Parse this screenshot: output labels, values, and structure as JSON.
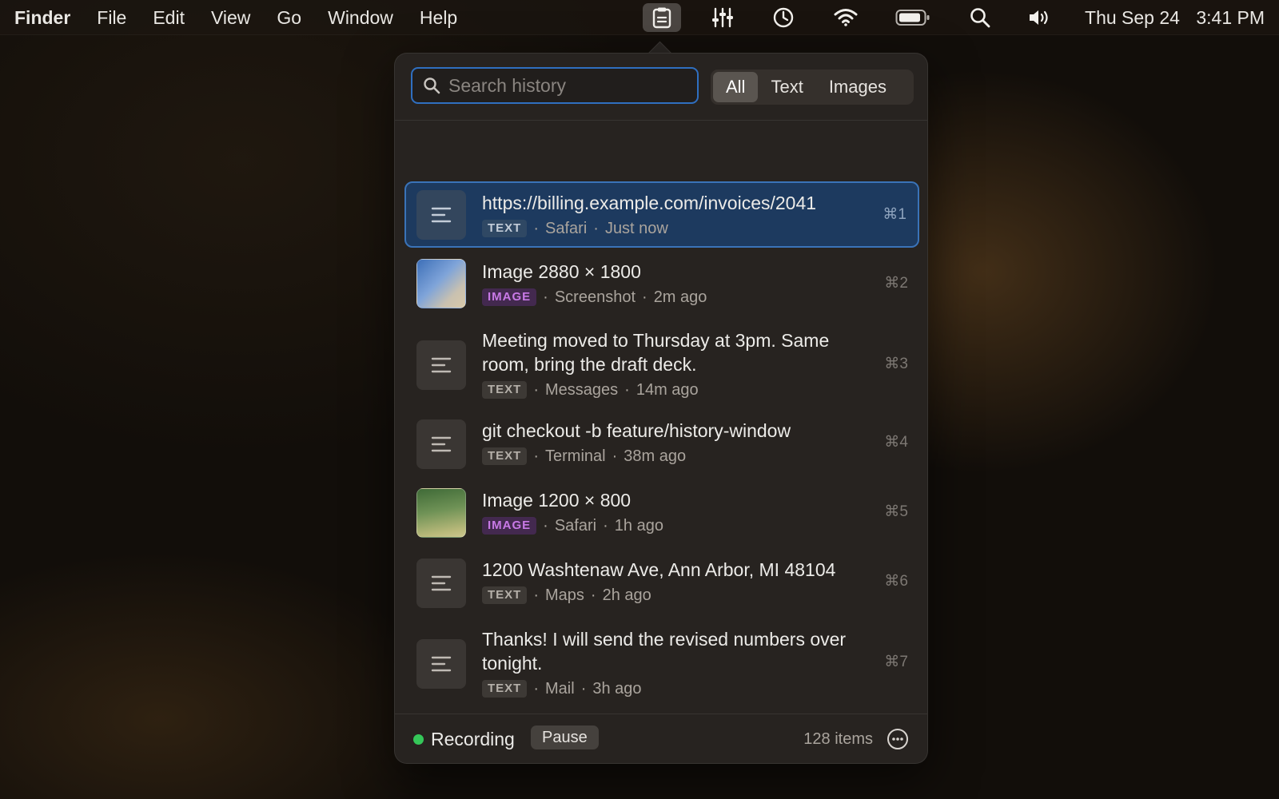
{
  "menubar": {
    "app_name": "Finder",
    "menus": [
      "File",
      "Edit",
      "View",
      "Go",
      "Window",
      "Help"
    ],
    "status_icons": [
      "clipboard-icon",
      "mixer-icon",
      "clock-icon",
      "wifi-icon",
      "battery-icon",
      "search-icon",
      "volume-icon"
    ],
    "date": "Thu Sep 24",
    "time": "3:41 PM"
  },
  "popover": {
    "search": {
      "placeholder": "Search history",
      "value": ""
    },
    "filters": [
      {
        "label": "All",
        "selected": true
      },
      {
        "label": "Text",
        "selected": false
      },
      {
        "label": "Images",
        "selected": false
      }
    ],
    "items": [
      {
        "title": "https://billing.example.com/invoices/2041",
        "type": "TEXT",
        "source": "Safari",
        "time": "Just now",
        "shortcut": "⌘1",
        "selected": true
      },
      {
        "title": "Image 2880 × 1800",
        "type": "IMAGE",
        "source": "Screenshot",
        "time": "2m ago",
        "shortcut": "⌘2"
      },
      {
        "title": "Meeting moved to Thursday at 3pm. Same room, bring the draft deck.",
        "type": "TEXT",
        "source": "Messages",
        "time": "14m ago",
        "shortcut": "⌘3"
      },
      {
        "title": "git checkout -b feature/history-window",
        "type": "TEXT",
        "source": "Terminal",
        "time": "38m ago",
        "shortcut": "⌘4"
      },
      {
        "title": "Image 1200 × 800",
        "type": "IMAGE",
        "source": "Safari",
        "time": "1h ago",
        "shortcut": "⌘5"
      },
      {
        "title": "1200 Washtenaw Ave, Ann Arbor, MI 48104",
        "type": "TEXT",
        "source": "Maps",
        "time": "2h ago",
        "shortcut": "⌘6"
      },
      {
        "title": "Thanks! I will send the revised numbers over tonight.",
        "type": "TEXT",
        "source": "Mail",
        "time": "3h ago",
        "shortcut": "⌘7"
      }
    ],
    "footer": {
      "status": "Recording",
      "pause_label": "Pause",
      "count": "128 items"
    }
  },
  "colors": {
    "accent": "#2f6fc0",
    "selected_row": "#1d3a5f",
    "recording": "#35c759",
    "image_badge": "#c879e6"
  }
}
